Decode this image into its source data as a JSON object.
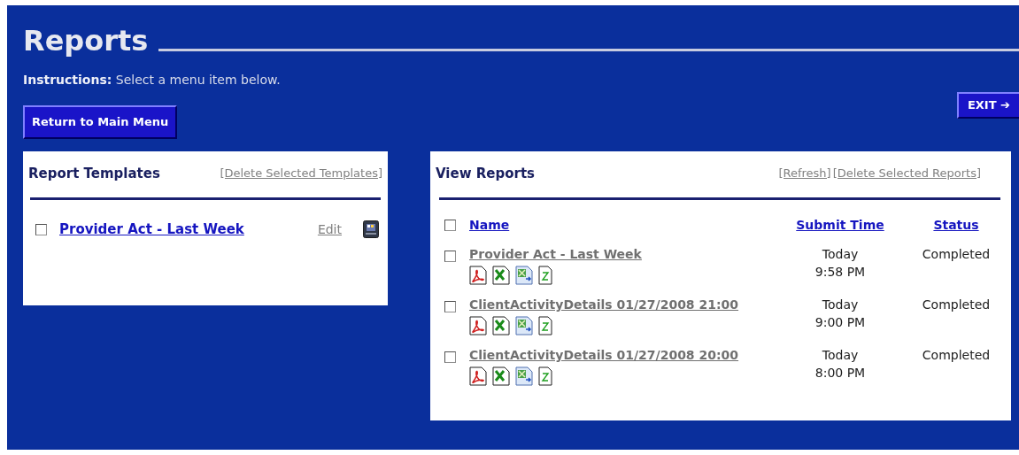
{
  "page": {
    "title": "Reports",
    "instructions_label": "Instructions:",
    "instructions": "Select a menu item below."
  },
  "buttons": {
    "exit": "EXIT ➔",
    "main_menu": "Return to Main Menu"
  },
  "templates": {
    "title": "Report Templates",
    "delete_link": "[Delete Selected Templates]",
    "items": [
      {
        "name": "Provider Act - Last Week",
        "checked": false,
        "edit": "Edit"
      }
    ]
  },
  "reports": {
    "title": "View Reports",
    "refresh_link": "[Refresh]",
    "delete_link": "[Delete Selected Reports]",
    "header": {
      "checked": false,
      "columns": [
        "Name",
        "Submit Time",
        "Status"
      ]
    },
    "rows": [
      {
        "name": "Provider Act - Last Week",
        "checked": false,
        "day": "Today",
        "time": "9:58 PM",
        "status": "Completed"
      },
      {
        "name": "ClientActivityDetails 01/27/2008 21:00",
        "checked": false,
        "day": "Today",
        "time": "9:00 PM",
        "status": "Completed"
      },
      {
        "name": "ClientActivityDetails 01/27/2008 20:00",
        "checked": false,
        "day": "Today",
        "time": "8:00 PM",
        "status": "Completed"
      }
    ]
  }
}
